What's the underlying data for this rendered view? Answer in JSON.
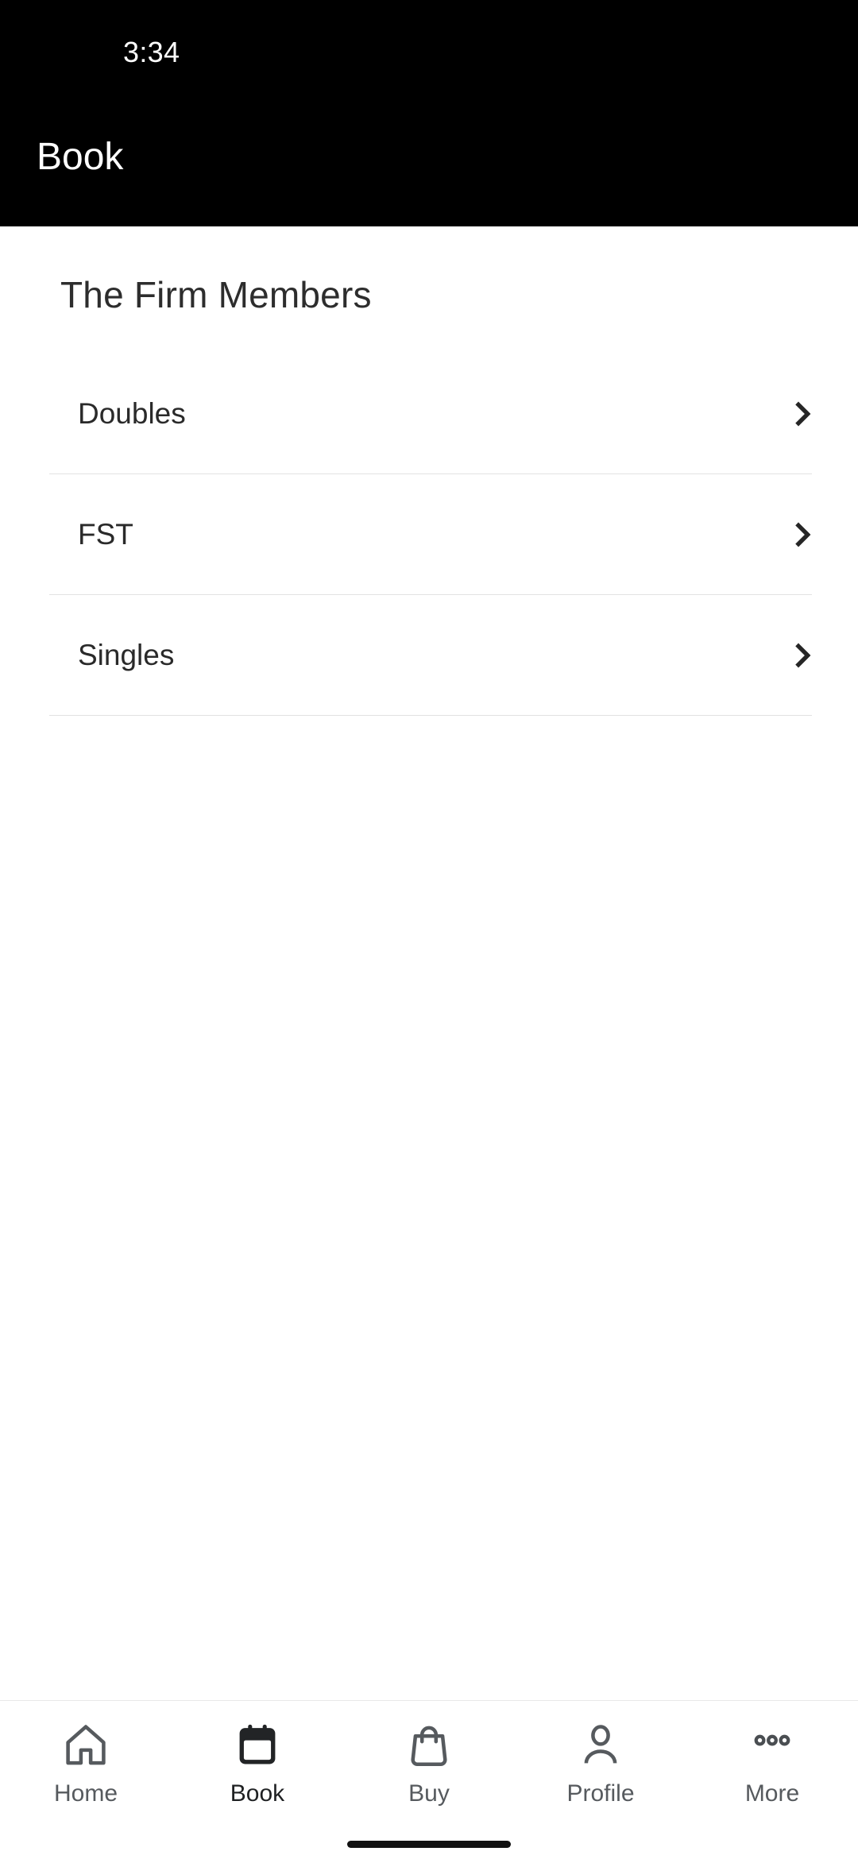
{
  "status_bar": {
    "time": "3:34"
  },
  "app_bar": {
    "title": "Book"
  },
  "page": {
    "title": "The Firm Members"
  },
  "list": {
    "items": [
      {
        "label": "Doubles",
        "chevron_icon": "chevron-right-icon"
      },
      {
        "label": "FST",
        "chevron_icon": "chevron-right-icon"
      },
      {
        "label": "Singles",
        "chevron_icon": "chevron-right-icon"
      }
    ]
  },
  "tab_bar": {
    "items": [
      {
        "label": "Home",
        "icon": "home-icon",
        "active": false
      },
      {
        "label": "Book",
        "icon": "calendar-icon",
        "active": true
      },
      {
        "label": "Buy",
        "icon": "shopping-bag-icon",
        "active": false
      },
      {
        "label": "Profile",
        "icon": "person-icon",
        "active": false
      },
      {
        "label": "More",
        "icon": "ellipsis-icon",
        "active": false
      }
    ]
  },
  "colors": {
    "app_bar_background": "#000000",
    "app_bar_text": "#ffffff",
    "page_background": "#ffffff",
    "title_text": "#2d2d2d",
    "list_text": "#2a2a2a",
    "divider": "#e2e2e2",
    "tab_inactive": "#565a5e",
    "tab_active": "#1f2123",
    "home_indicator": "#111111"
  }
}
